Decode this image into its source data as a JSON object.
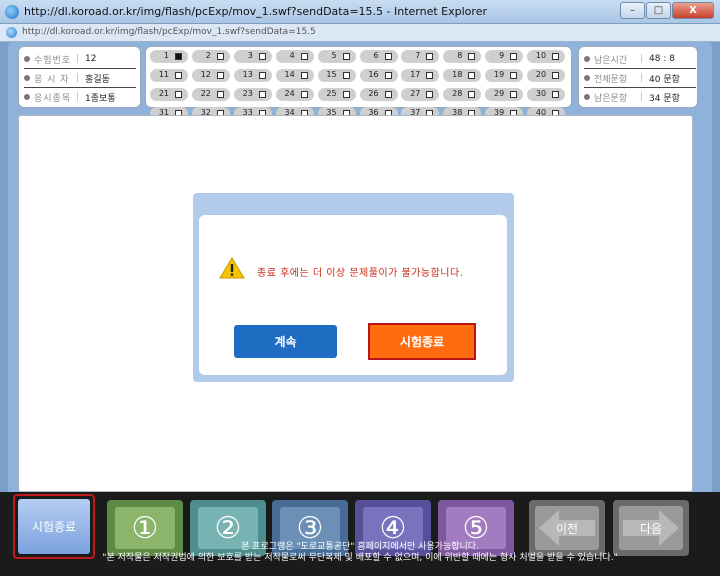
{
  "window": {
    "title": "http://dl.koroad.or.kr/img/flash/pcExp/mov_1.swf?sendData=15.5 - Internet Explorer",
    "address": "http://dl.koroad.or.kr/img/flash/pcExp/mov_1.swf?sendData=15.5",
    "min_label": "–",
    "max_label": "□",
    "close_label": "X"
  },
  "exam_info": {
    "exam_number_label": "수험번호",
    "exam_number": "12",
    "examinee_label": "응 시 자",
    "examinee": "홍길동",
    "exam_type_label": "응시종목",
    "exam_type": "1종보통"
  },
  "questions": {
    "current": 1,
    "numbers": [
      1,
      2,
      3,
      4,
      5,
      6,
      7,
      8,
      9,
      10,
      11,
      12,
      13,
      14,
      15,
      16,
      17,
      18,
      19,
      20,
      21,
      22,
      23,
      24,
      25,
      26,
      27,
      28,
      29,
      30,
      31,
      32,
      33,
      34,
      35,
      36,
      37,
      38,
      39,
      40
    ]
  },
  "status": {
    "remaining_time_label": "남은시간",
    "remaining_time": "48 :  8",
    "total_label": "전체문항",
    "total": "40 문항",
    "remaining_label": "남은문항",
    "remaining": "34 문항"
  },
  "modal": {
    "message": "종료 후에는 더 이상 문제풀이가 불가능합니다.",
    "continue_label": "계속",
    "end_label": "시험종료",
    "warning_color": "#f5c400"
  },
  "bottom": {
    "end_label": "시험종료",
    "answers": [
      "①",
      "②",
      "③",
      "④",
      "⑤"
    ],
    "prev_label": "이전",
    "next_label": "다음",
    "notice_line1": "본 프로그램은 \"도로교통공단\" 홈페이지에서만 사용가능합니다.",
    "notice_line2": "\"본 저작물은 저작권법에 의한 보호를 받는 저작물로써 무단복제 및 배포할 수 없으며, 이에 위반할 때에는 형사 처벌을 받을 수 있습니다.\""
  },
  "colors": {
    "answer_1": "#8ab56a",
    "answer_2": "#77b3b3",
    "answer_3": "#6b8fb5",
    "answer_4": "#7a72bd",
    "answer_5": "#a27bc0",
    "nav": "#8a8a8a"
  }
}
